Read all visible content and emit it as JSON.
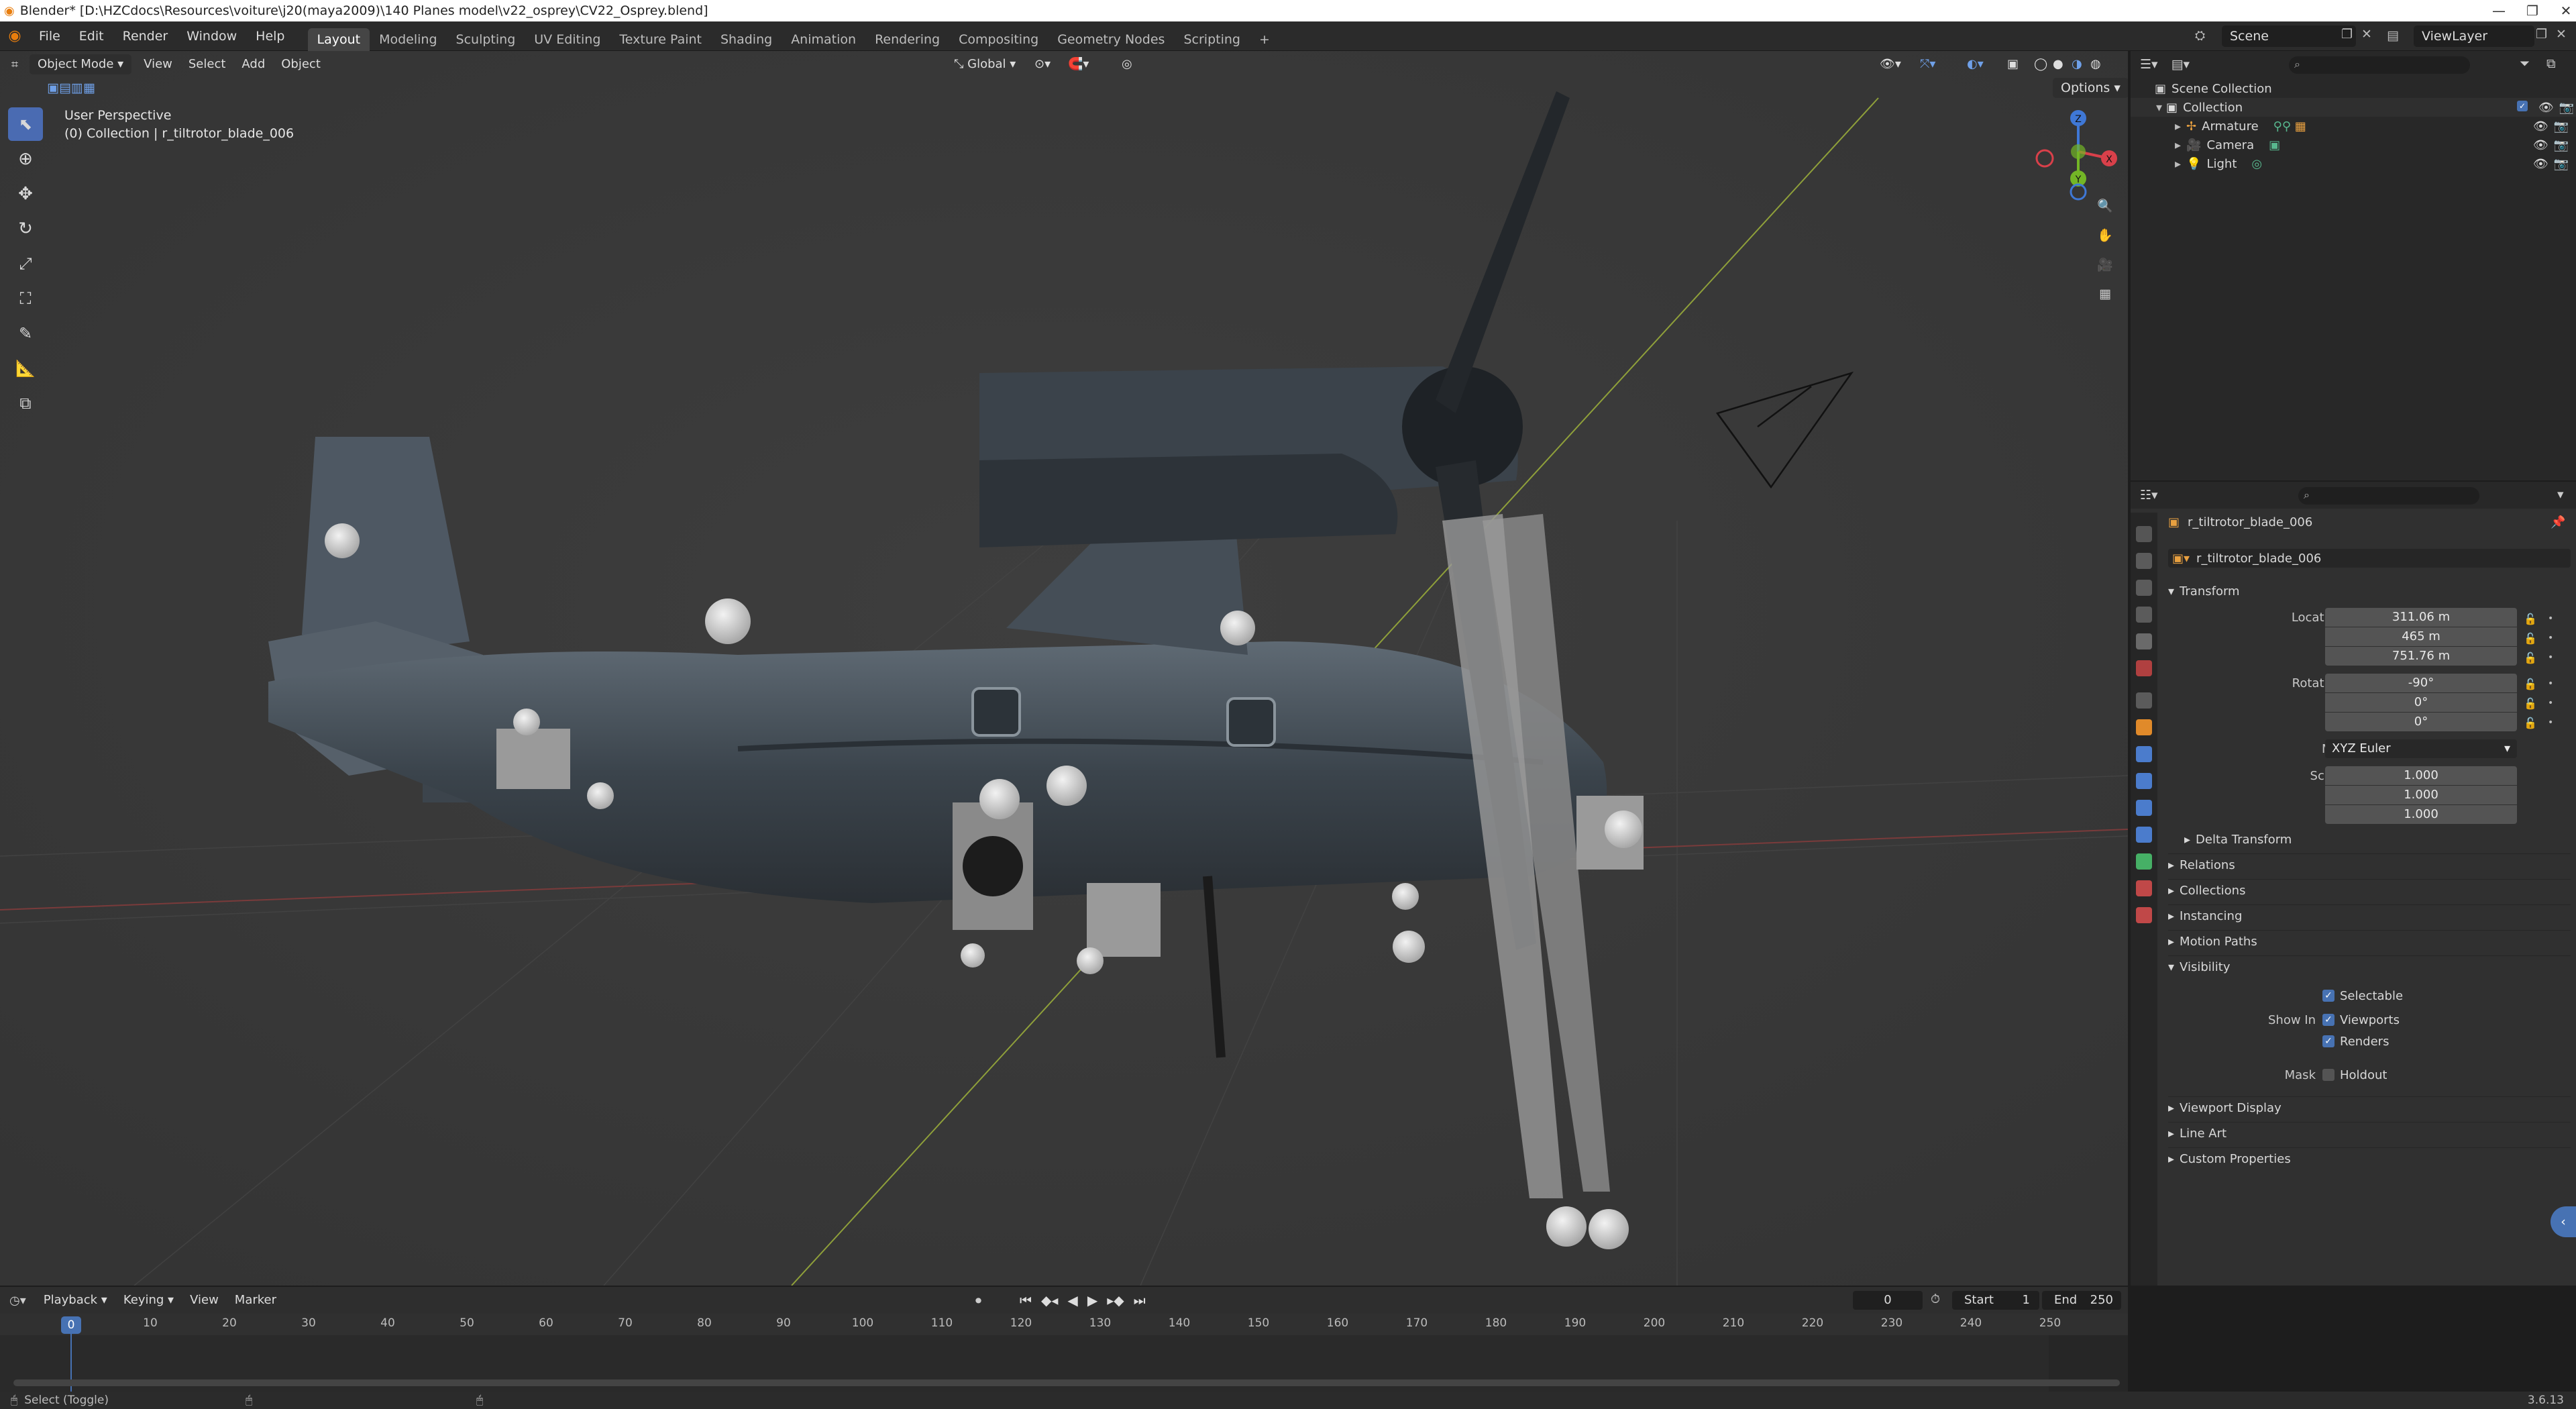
{
  "window": {
    "title": "Blender* [D:\\HZCdocs\\Resources\\voiture\\j20(maya2009)\\140 Planes model\\v22_osprey\\CV22_Osprey.blend]"
  },
  "menu": [
    "File",
    "Edit",
    "Render",
    "Window",
    "Help"
  ],
  "workspaces": [
    "Layout",
    "Modeling",
    "Sculpting",
    "UV Editing",
    "Texture Paint",
    "Shading",
    "Animation",
    "Rendering",
    "Compositing",
    "Geometry Nodes",
    "Scripting"
  ],
  "scene": {
    "label": "Scene",
    "view_layer": "ViewLayer"
  },
  "viewport": {
    "mode": "Object Mode",
    "menus": [
      "View",
      "Select",
      "Add",
      "Object"
    ],
    "orientation": "Global",
    "options_label": "Options",
    "info_line1": "User Perspective",
    "info_line2": "(0) Collection | r_tiltrotor_blade_006",
    "gizmo": {
      "x": "X",
      "y": "Y",
      "z": "Z"
    }
  },
  "outliner": {
    "root": "Scene Collection",
    "collection": "Collection",
    "items": [
      {
        "name": "Armature"
      },
      {
        "name": "Camera"
      },
      {
        "name": "Light"
      }
    ]
  },
  "properties": {
    "object_name": "r_tiltrotor_blade_006",
    "data_name": "r_tiltrotor_blade_006",
    "transform_title": "Transform",
    "location": {
      "label": "Location X",
      "x": "311.06 m",
      "y": "465 m",
      "z": "751.76 m"
    },
    "rotation": {
      "label": "Rotation X",
      "x": "-90°",
      "y": "0°",
      "z": "0°"
    },
    "mode": {
      "label": "Mode",
      "value": "XYZ Euler"
    },
    "scale": {
      "label": "Scale X",
      "x": "1.000",
      "y": "1.000",
      "z": "1.000"
    },
    "axis_y": "Y",
    "axis_z": "Z",
    "delta_transform": "Delta Transform",
    "sections": [
      "Relations",
      "Collections",
      "Instancing",
      "Motion Paths"
    ],
    "visibility": {
      "title": "Visibility",
      "selectable": "Selectable",
      "show_in": "Show In",
      "viewports": "Viewports",
      "renders": "Renders",
      "mask": "Mask",
      "holdout": "Holdout"
    },
    "sections_after": [
      "Viewport Display",
      "Line Art",
      "Custom Properties"
    ]
  },
  "timeline": {
    "menus": [
      "Playback",
      "Keying",
      "View",
      "Marker"
    ],
    "current_frame": "0",
    "start_label": "Start",
    "start": "1",
    "end_label": "End",
    "end": "250",
    "ruler": [
      "0",
      "10",
      "20",
      "30",
      "40",
      "50",
      "60",
      "70",
      "80",
      "90",
      "100",
      "110",
      "120",
      "130",
      "140",
      "150",
      "160",
      "170",
      "180",
      "190",
      "200",
      "210",
      "220",
      "230",
      "240",
      "250"
    ]
  },
  "status": {
    "left": "Select (Toggle)",
    "version": "3.6.13"
  },
  "colors": {
    "accent": "#4772b3",
    "viewport_bg": "#393939",
    "panel_bg": "#303030",
    "x_axis": "#d9404a",
    "y_axis": "#73b626",
    "z_axis": "#3f78d6"
  }
}
